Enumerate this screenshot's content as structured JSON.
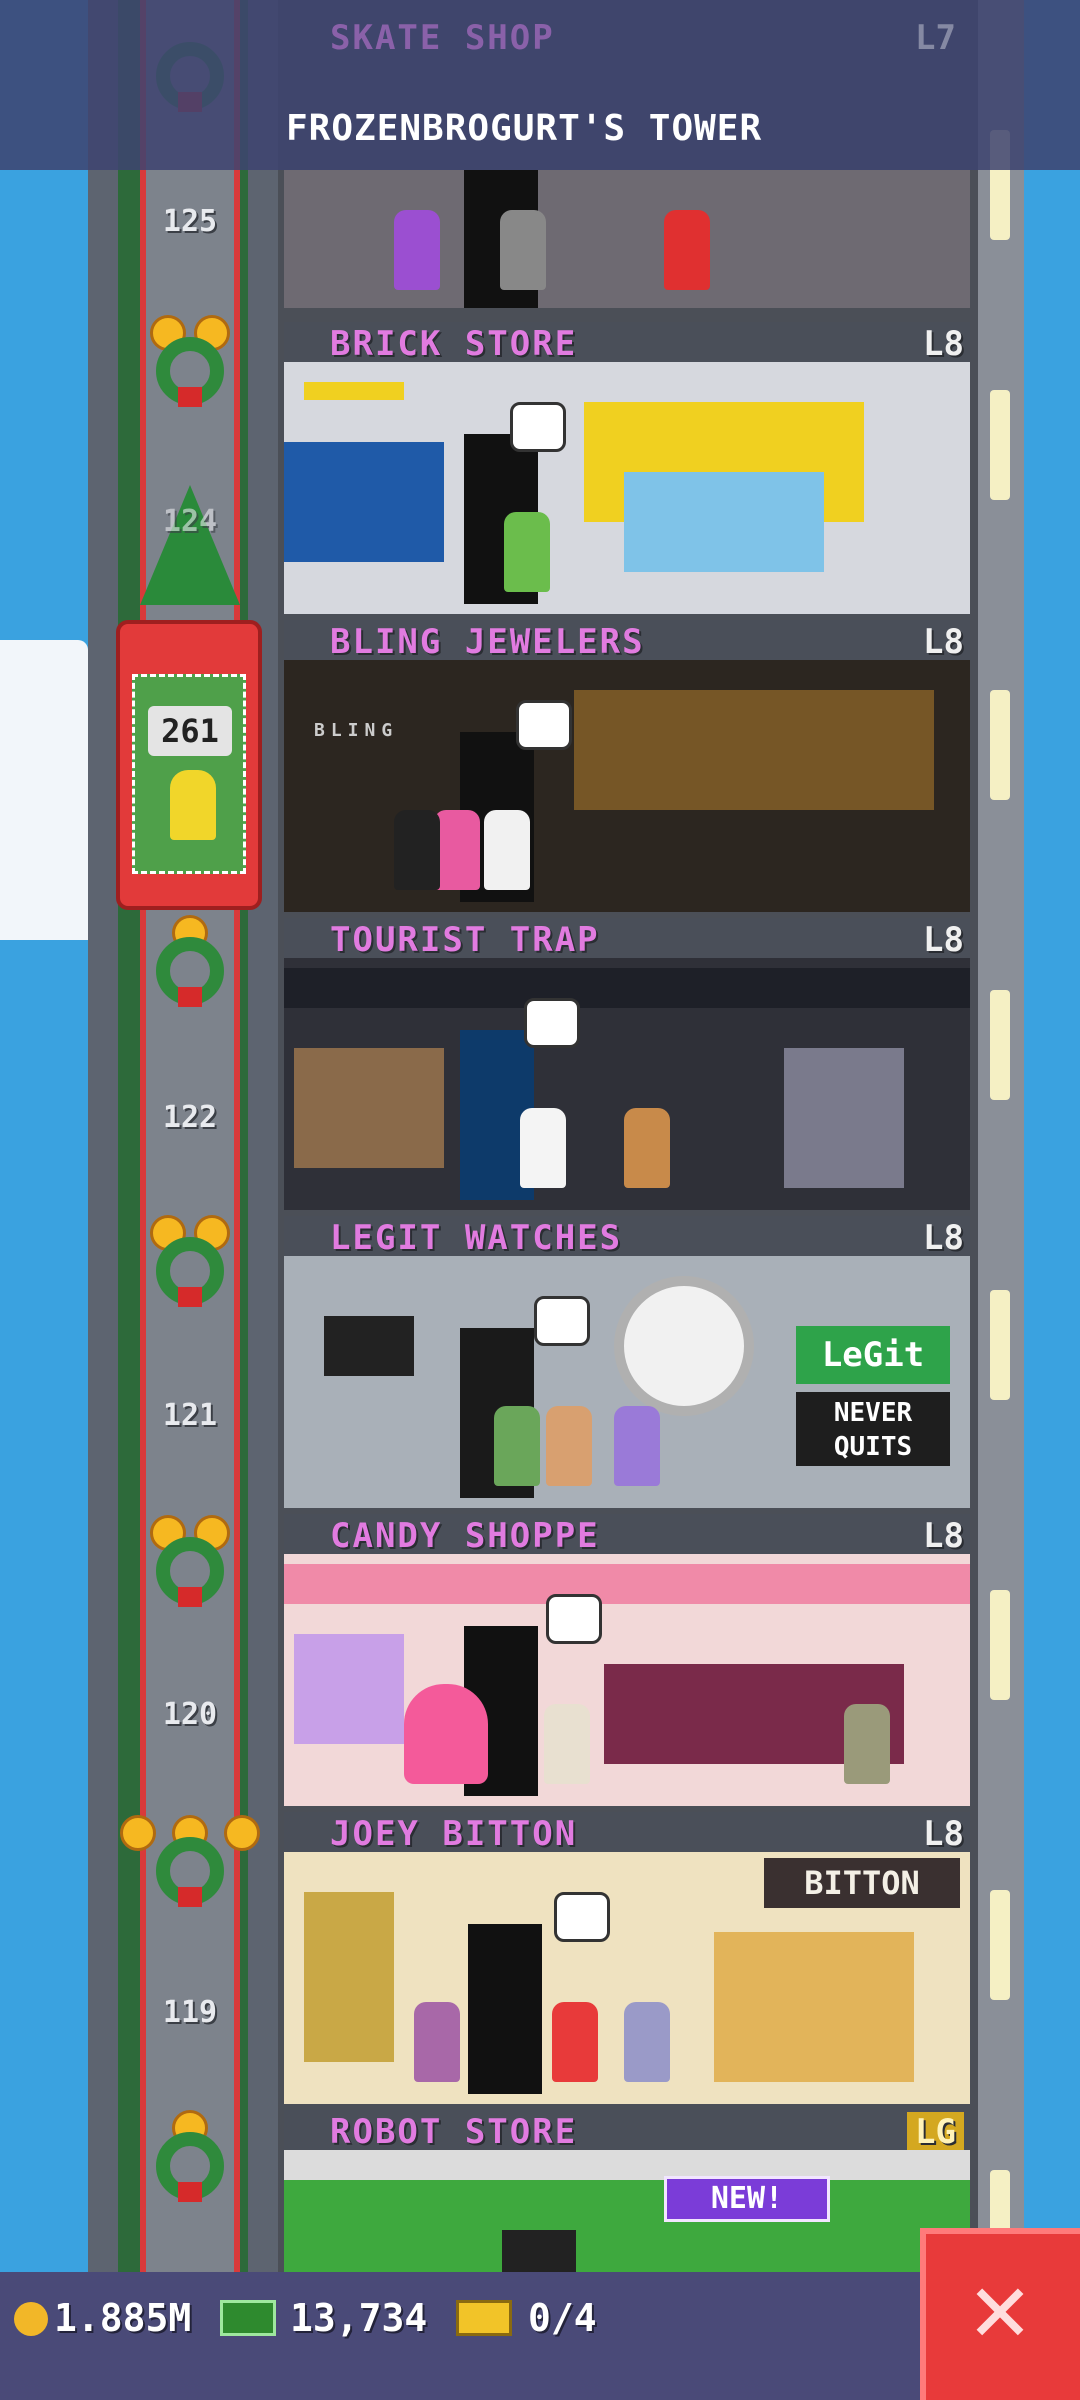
{
  "header": {
    "partial_floor_name": "SKATE SHOP",
    "partial_floor_level": "L7",
    "tower_title": "FROZENBROGURT'S TOWER"
  },
  "elevator": {
    "car_number": "261",
    "shaft_numbers": [
      "125",
      "124",
      "122",
      "121",
      "120",
      "119"
    ]
  },
  "floors": [
    {
      "name": "BRICK STORE",
      "level": "L8"
    },
    {
      "name": "BLING JEWELERS",
      "level": "L8"
    },
    {
      "name": "TOURIST TRAP",
      "level": "L8"
    },
    {
      "name": "LEGIT WATCHES",
      "level": "L8"
    },
    {
      "name": "CANDY SHOPPE",
      "level": "L8"
    },
    {
      "name": "JOEY BITTON",
      "level": "L8"
    },
    {
      "name": "ROBOT STORE",
      "level": "LG"
    }
  ],
  "signs": {
    "legit_logo": "LeGit",
    "legit_slogan": "NEVER QUITS",
    "bitton_sign": "BITTON",
    "bling_sign": "BLING",
    "new_badge": "NEW!"
  },
  "bottom_bar": {
    "coins": "1.885M",
    "bux": "13,734",
    "tickets": "0/4"
  },
  "colors": {
    "sky": "#3aa2e0",
    "floor_name": "#e17be0",
    "close_button": "#e83a3a",
    "bottom_bar": "#4a4a78"
  },
  "icons": {
    "coins": "coin-icon",
    "bux": "cash-icon",
    "tickets": "ticket-icon",
    "close": "close-icon"
  }
}
